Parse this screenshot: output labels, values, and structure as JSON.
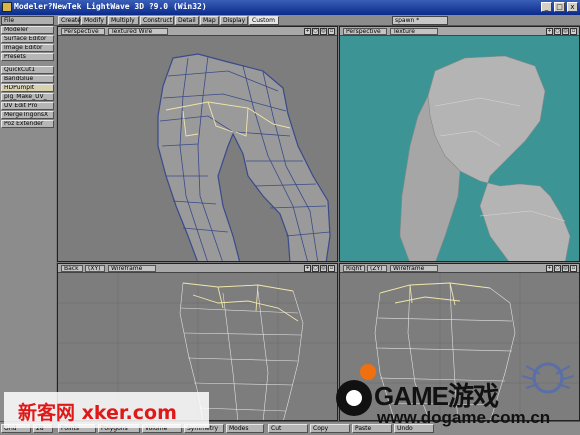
{
  "window": {
    "title": "Modeler?NewTek LightWave 3D ?9.0 (Win32)",
    "btn_min": "_",
    "btn_max": "□",
    "btn_close": "x"
  },
  "tabs": [
    {
      "label": "Create"
    },
    {
      "label": "Modify"
    },
    {
      "label": "Multiply"
    },
    {
      "label": "Construct"
    },
    {
      "label": "Detail"
    },
    {
      "label": "Map"
    },
    {
      "label": "Display"
    },
    {
      "label": "Custom"
    }
  ],
  "file_menu": "File",
  "spawn_select": "spawn *",
  "sidebar": {
    "items": [
      {
        "label": "Modeler"
      },
      {
        "label": "Surface Editor"
      },
      {
        "label": "Image Editor"
      },
      {
        "label": "Presets"
      },
      {
        "label": "QuickCut1"
      },
      {
        "label": "BandGlue"
      },
      {
        "label": "HDPumpIt"
      },
      {
        "label": "plg_Make_UV_"
      },
      {
        "label": "UV Edit Pro"
      },
      {
        "label": "MergeTrigonsX"
      },
      {
        "label": "Poz Extender"
      }
    ]
  },
  "viewports": {
    "top_left": {
      "view": "Perspective",
      "mode": "Textured Wire"
    },
    "top_right": {
      "view": "Perspective",
      "mode": "Texture"
    },
    "bottom_left": {
      "view": "Back",
      "axis": "(XY)",
      "mode": "Wireframe"
    },
    "bottom_right": {
      "view": "Right",
      "axis": "(ZY)",
      "mode": "Wireframe"
    }
  },
  "viewport_icons": [
    "move-icon",
    "rotate-icon",
    "zoom-icon",
    "maximize-icon"
  ],
  "status": {
    "grid": "Grid",
    "grid_value": "28",
    "points": "Points",
    "polygons": "Polygons",
    "volume": "Volume",
    "symmetry": "Symmetry",
    "modes": "Modes",
    "cut": "Cut",
    "copy": "Copy",
    "paste": "Paste",
    "undo": "Undo"
  },
  "watermarks": {
    "left": "新客网 xker.com",
    "right_big": "GAME游戏",
    "right_url": "www.dogame.com.cn"
  },
  "colors": {
    "titlebar": "#0a2a8a",
    "viewport_grey": "#7d7d7d",
    "viewport_teal": "#3d9494",
    "mesh_fill": "#a9a9a9",
    "wire_blue": "#3a4a8a",
    "selected_wire": "#f0e6a8"
  }
}
